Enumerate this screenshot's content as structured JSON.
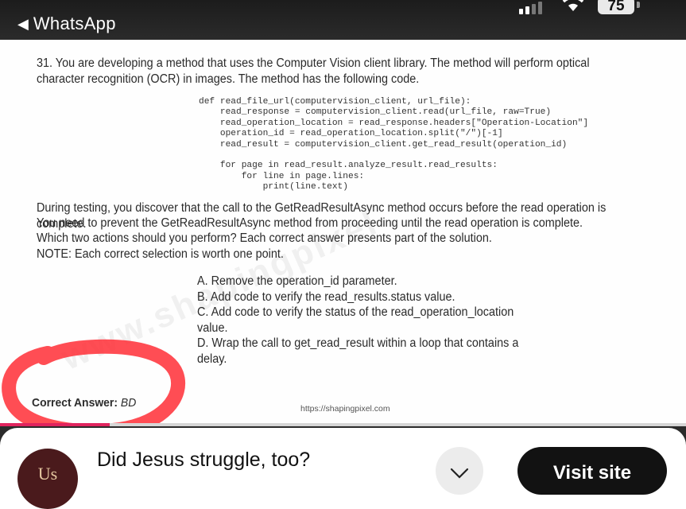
{
  "status_bar": {
    "back_arrow": "◀",
    "back_label": "WhatsApp",
    "battery_level": "75"
  },
  "question": {
    "text": "31. You are developing a method that uses the Computer Vision client library. The method will perform optical character recognition (OCR) in images. The method has the following code.",
    "code_lines": [
      "def read_file_url(computervision_client, url_file):",
      "    read_response = computervision_client.read(url_file, raw=True)",
      "    read_operation_location = read_response.headers[\"Operation-Location\"]",
      "    operation_id = read_operation_location.split(\"/\")[-1]",
      "    read_result = computervision_client.get_read_result(operation_id)",
      "",
      "    for page in read_result.analyze_result.read_results:",
      "        for line in page.lines:",
      "            print(line.text)"
    ],
    "testing": "During testing, you discover that the call to the GetReadResultAsync method occurs before the read operation is complete.",
    "need": "You need to prevent the GetReadResultAsync method from proceeding until the read operation is complete.",
    "prompt": "Which two actions should you perform? Each correct answer presents part of the solution.",
    "note": "NOTE: Each correct selection is worth one point.",
    "options": [
      "A. Remove the operation_id parameter.",
      "B. Add code to verify the read_results.status value.",
      "C. Add code to verify the status of the read_operation_location value.",
      "D. Wrap the call to get_read_result within a loop that contains a delay."
    ],
    "answer_label": "Correct Answer:",
    "answer_value": "BD",
    "source_url": "https://shapingpixel.com",
    "watermark": "www.shapingpixel"
  },
  "progress_fraction": 0.16,
  "ad": {
    "logo_text": "Us",
    "title": "Did Jesus struggle, too?",
    "visit_label": "Visit site"
  },
  "colors": {
    "annotation_red": "#ff2e36",
    "progress_pink": "#e0245e"
  }
}
